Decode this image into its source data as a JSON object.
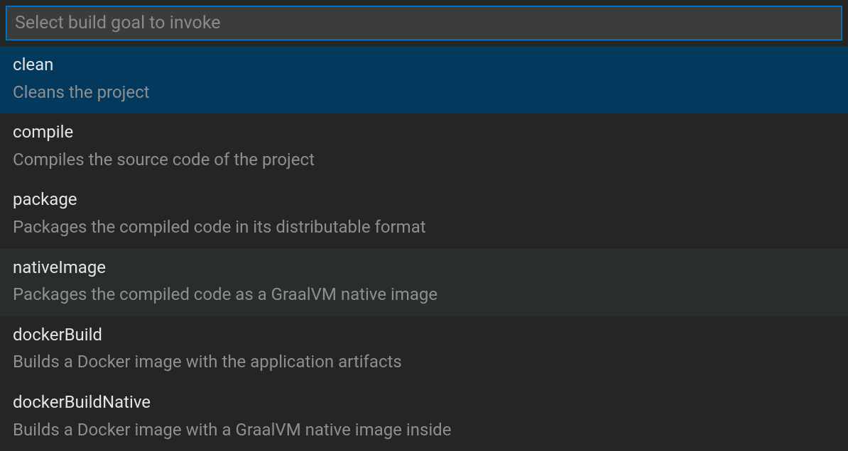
{
  "input": {
    "placeholder": "Select build goal to invoke",
    "value": ""
  },
  "items": [
    {
      "label": "clean",
      "description": "Cleans the project",
      "state": "selected"
    },
    {
      "label": "compile",
      "description": "Compiles the source code of the project",
      "state": "normal"
    },
    {
      "label": "package",
      "description": "Packages the compiled code in its distributable format",
      "state": "normal"
    },
    {
      "label": "nativeImage",
      "description": "Packages the compiled code as a GraalVM native image",
      "state": "hover"
    },
    {
      "label": "dockerBuild",
      "description": "Builds a Docker image with the application artifacts",
      "state": "normal"
    },
    {
      "label": "dockerBuildNative",
      "description": "Builds a Docker image with a GraalVM native image inside",
      "state": "normal"
    }
  ]
}
